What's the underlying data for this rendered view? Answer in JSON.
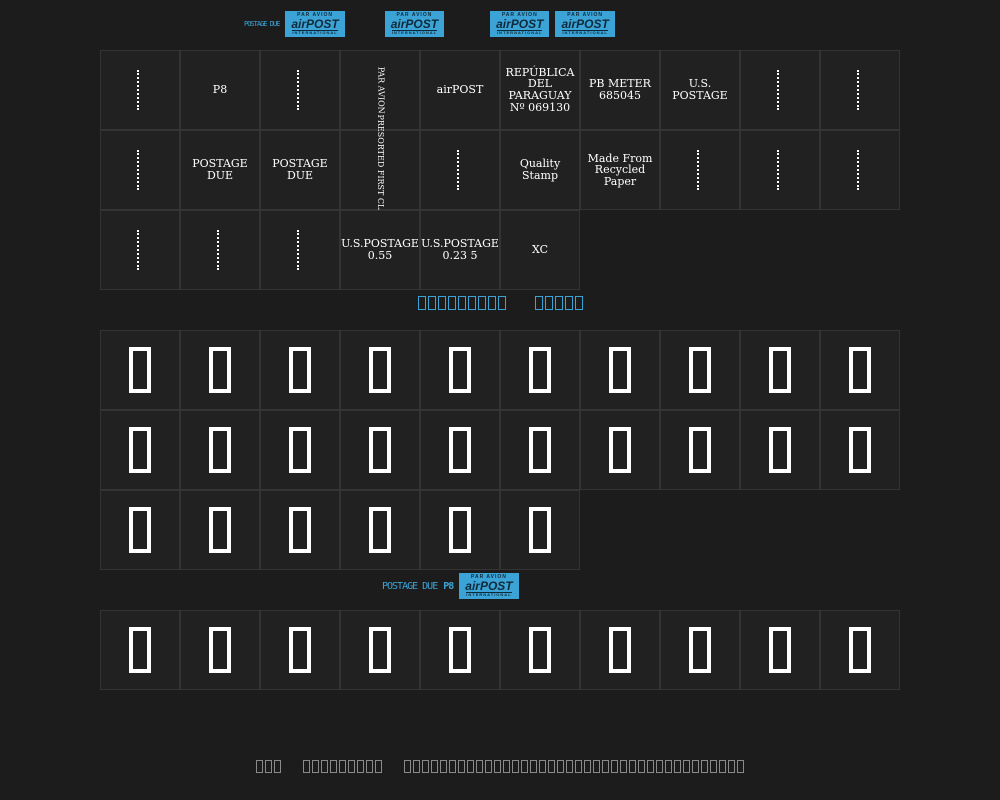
{
  "accent_color": "#3ba3d6",
  "background_color": "#1c1c1c",
  "top_banner": {
    "stamp_top": "PAR AVION",
    "stamp_mid": "airPOST",
    "stamp_bot": "INTERNATIONAL",
    "scribble": "POSTAGE DUE"
  },
  "glyph_rows": [
    [
      "",
      "P8",
      "",
      "PAR AVION",
      "airPOST",
      "REPÚBLICA DEL PARAGUAY  Nº 069130",
      "PB METER 685045",
      "U.S. POSTAGE",
      "",
      ""
    ],
    [
      "",
      "POSTAGE DUE",
      "POSTAGE DUE",
      "PRESORTED FIRST CLASS",
      "",
      "Quality Stamp",
      "Made From Recycled Paper",
      "",
      "",
      ""
    ],
    [
      "",
      "",
      "",
      "U.S.POSTAGE 0.55",
      "U.S.POSTAGE 0.23 5",
      "XC"
    ]
  ],
  "section_heading_chars": 14,
  "tofu_rows": [
    10,
    10,
    6
  ],
  "tofu_row_numbers": 10,
  "mid_banner": {
    "scribble": "POSTAGE DUE",
    "pb": "P8",
    "stamp_top": "PAR AVION",
    "stamp_mid": "airPOST",
    "stamp_bot": "INTERNATIONAL"
  },
  "footer_groups": [
    3,
    9,
    38
  ]
}
